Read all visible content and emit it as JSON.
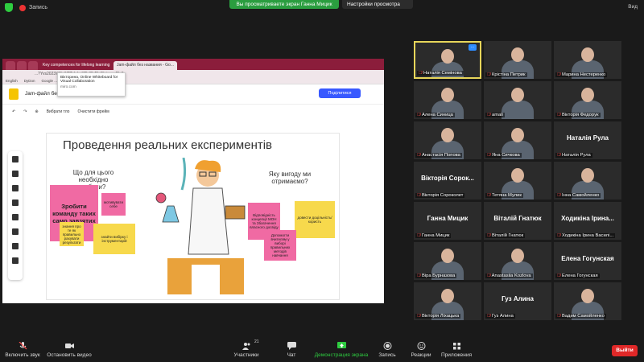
{
  "topbar": {
    "recording_label": "Запись",
    "sharing_banner": "Вы просматриваете экран Ганна Мицик",
    "view_options": "Настройки просмотра",
    "view_label": "Вид"
  },
  "browser": {
    "tabs": [
      "Key competences for lifelong learning",
      "Jam-файл без названия - Go..."
    ],
    "address": "...?Yvs2023YMwN2TaIuhxXPqSLJ5o8/viewer?f=0",
    "bookmarks": [
      "English",
      "DyDon",
      "Remove Backgrou...",
      "Google ..."
    ],
    "tooltip_title": "Вікторина, Online Whiteboard for Visual Collaboration",
    "tooltip_url": "miro.com"
  },
  "miro": {
    "board_title": "Jam-файл без названия",
    "share_button": "Поділитися",
    "toolbar": {
      "select_background": "Вибрати тло",
      "clear_frame": "Очистити фрейм"
    },
    "frame_title": "Проведення реальних експериментів",
    "question_left": "Що для цього необхідно робити?",
    "question_right": "Яку вигоду ми отримаємо?",
    "stickies": {
      "pink_big": "Зробити команду таких само завзятих",
      "pink_small": "мотивувати себе",
      "yellow1": "знання про те як правильно рахувати результати",
      "yellow2": "знайти вибірку і інструментарій",
      "pink3": "Відповідність концепції МОН та Збагачення власного досвіду",
      "yellow3": "довести доцільність/користь",
      "pink4": "Допомогти вчителям у виборі правильних методів навчання"
    }
  },
  "gallery": [
    {
      "name": "Наталія Семінова",
      "big": "",
      "highlight": true
    },
    {
      "name": "Крістіна Петрик",
      "big": ""
    },
    {
      "name": "Марина Нестеренко",
      "big": ""
    },
    {
      "name": "Алена Синица",
      "big": ""
    },
    {
      "name": "amali",
      "big": ""
    },
    {
      "name": "Вікторія Федорук",
      "big": ""
    },
    {
      "name": "Анастасія Попова",
      "big": ""
    },
    {
      "name": "Яна Сичкова",
      "big": ""
    },
    {
      "name": "Наталія Рула",
      "big": "Наталія Рула"
    },
    {
      "name": "Вікторія Сороколет",
      "big": "Вікторія Сорок..."
    },
    {
      "name": "Тетяна Мулик",
      "big": ""
    },
    {
      "name": "Інна Самойленко",
      "big": ""
    },
    {
      "name": "Ганна Мицик",
      "big": "Ганна Мицик"
    },
    {
      "name": "Віталій Гнатюк",
      "big": "Віталій Гнатюк"
    },
    {
      "name": "Ходикіна Ірина Василі...",
      "big": "Ходикіна Ірина..."
    },
    {
      "name": "Віра Бурназова",
      "big": ""
    },
    {
      "name": "Anastasiia Kozlova",
      "big": ""
    },
    {
      "name": "Елена Гогунская",
      "big": "Елена Гогунская"
    },
    {
      "name": "Вікторія Ліхацька",
      "big": ""
    },
    {
      "name": "Гуз Алина",
      "big": "Гуз Алина"
    },
    {
      "name": "Вадим Самойленко",
      "big": ""
    }
  ],
  "bottombar": {
    "unmute": "Включить звук",
    "stop_video": "Остановить видео",
    "participants": "Участники",
    "participants_count": "21",
    "chat": "Чат",
    "share_screen": "Демонстрация экрана",
    "record": "Запись",
    "reactions": "Реакции",
    "apps": "Приложения",
    "exit": "Выйти"
  },
  "colors": {
    "zoom_green": "#2a9d3f",
    "exit_red": "#e02828",
    "miro_blue": "#3859ff",
    "sticky_pink": "#f06aa3",
    "sticky_yellow": "#f7d94c"
  }
}
